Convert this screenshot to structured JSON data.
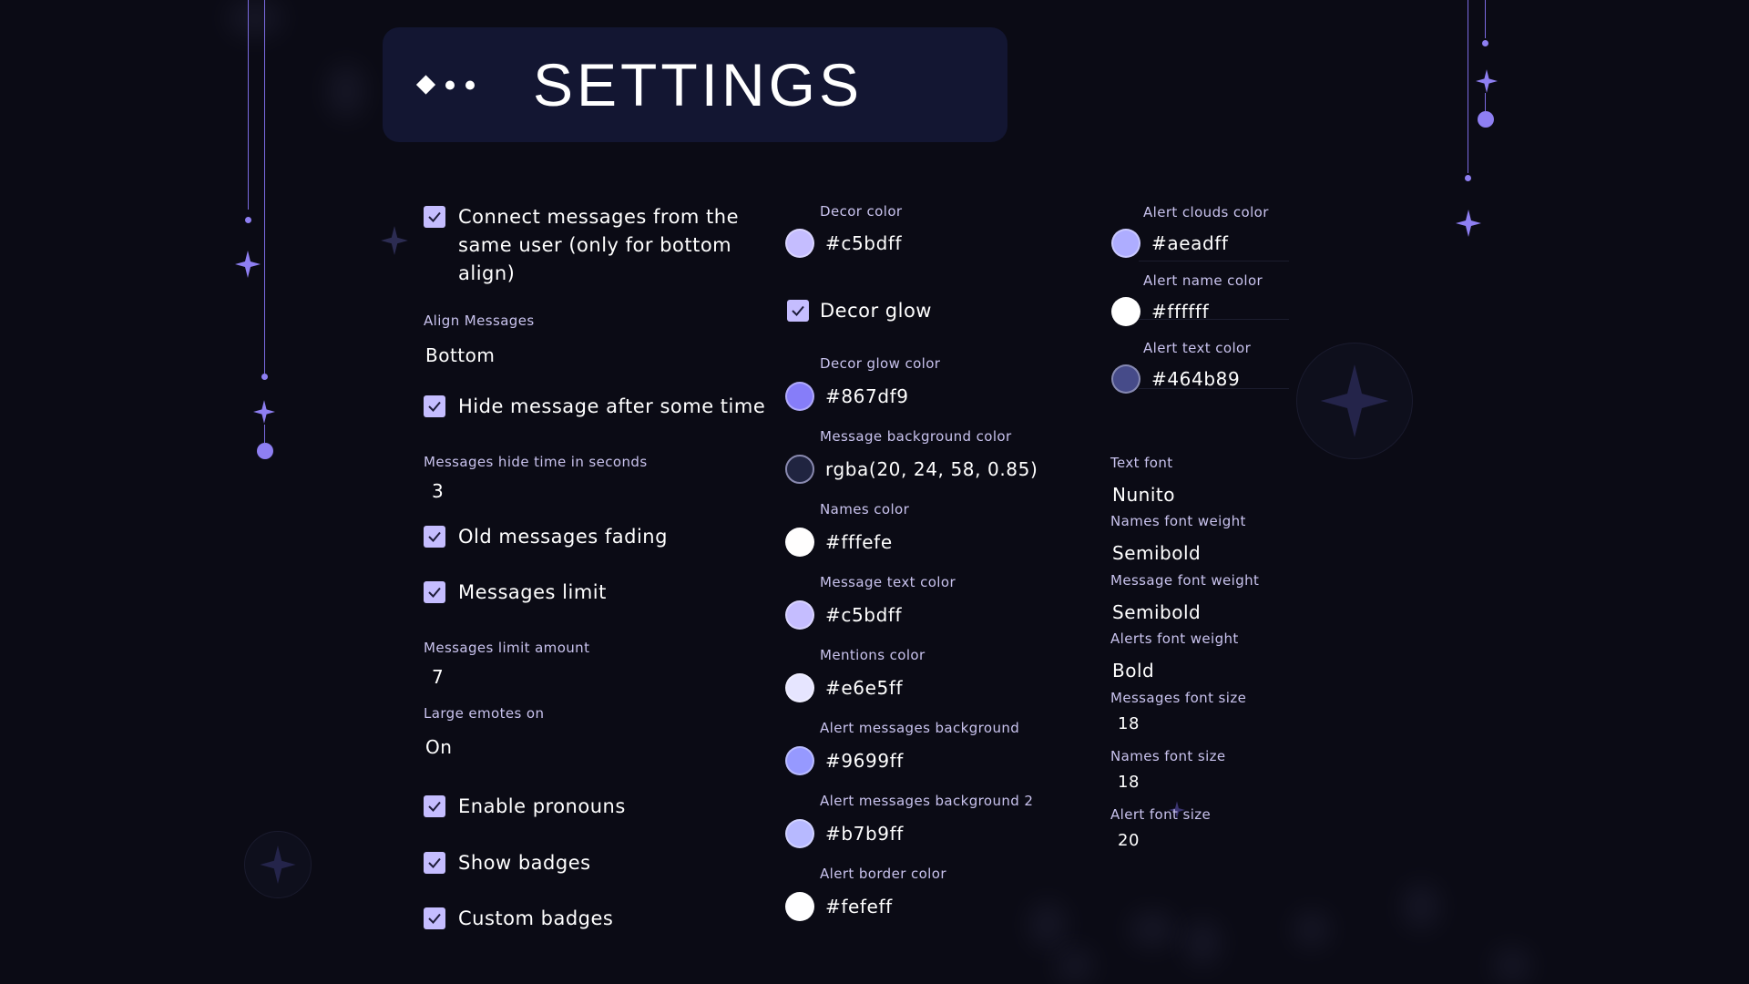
{
  "header": {
    "title": "SETTINGS"
  },
  "col1": {
    "connect": "Connect messages from the same user (only for bottom align)",
    "align_label": "Align Messages",
    "align_value": "Bottom",
    "hide_message": "Hide message after some time",
    "hide_time_label": "Messages hide time in seconds",
    "hide_time_value": "3",
    "old_fading": "Old messages fading",
    "limit": "Messages limit",
    "limit_amount_label": "Messages limit amount",
    "limit_amount_value": "7",
    "large_emotes_label": "Large emotes on",
    "large_emotes_value": "On",
    "pronouns": "Enable pronouns",
    "show_badges": "Show badges",
    "custom_badges": "Custom badges"
  },
  "col2": {
    "decor_label": "Decor color",
    "decor_value": "#c5bdff",
    "decor_glow": "Decor glow",
    "decor_glow_color_label": "Decor glow color",
    "decor_glow_color_value": "#867df9",
    "msg_bg_label": "Message background color",
    "msg_bg_value": "rgba(20, 24, 58, 0.85)",
    "names_color_label": "Names color",
    "names_color_value": "#fffefe",
    "msg_text_label": "Message text color",
    "msg_text_value": "#c5bdff",
    "mentions_label": "Mentions color",
    "mentions_value": "#e6e5ff",
    "alert_bg_label": "Alert messages background",
    "alert_bg_value": "#9699ff",
    "alert_bg2_label": "Alert messages background 2",
    "alert_bg2_value": "#b7b9ff",
    "alert_border_label": "Alert border color",
    "alert_border_value": "#fefeff"
  },
  "col3": {
    "alert_clouds_label": "Alert clouds color",
    "alert_clouds_value": "#aeadff",
    "alert_name_label": "Alert name color",
    "alert_name_value": "#ffffff",
    "alert_text_label": "Alert text color",
    "alert_text_value": "#464b89",
    "text_font_label": "Text font",
    "text_font_value": "Nunito",
    "names_weight_label": "Names font weight",
    "names_weight_value": "Semibold",
    "msg_weight_label": "Message font weight",
    "msg_weight_value": "Semibold",
    "alerts_weight_label": "Alerts font weight",
    "alerts_weight_value": "Bold",
    "msg_size_label": "Messages font size",
    "msg_size_value": "18",
    "names_size_label": "Names font size",
    "names_size_value": "18",
    "alert_size_label": "Alert font size",
    "alert_size_value": "20"
  },
  "colors": {
    "accent": "#c5bdff",
    "swatches": {
      "decor": "#c5bdff",
      "decor_glow": "#867df9",
      "msg_bg": "#202440",
      "names": "#fffefe",
      "msg_text": "#c5bdff",
      "mentions": "#e6e5ff",
      "alert_bg": "#9699ff",
      "alert_bg2": "#b7b9ff",
      "alert_border": "#fefeff",
      "alert_clouds": "#aeadff",
      "alert_name": "#ffffff",
      "alert_text": "#464b89"
    }
  },
  "icons": [
    "checkmark-icon",
    "diamond-icon",
    "sparkle-icon"
  ]
}
